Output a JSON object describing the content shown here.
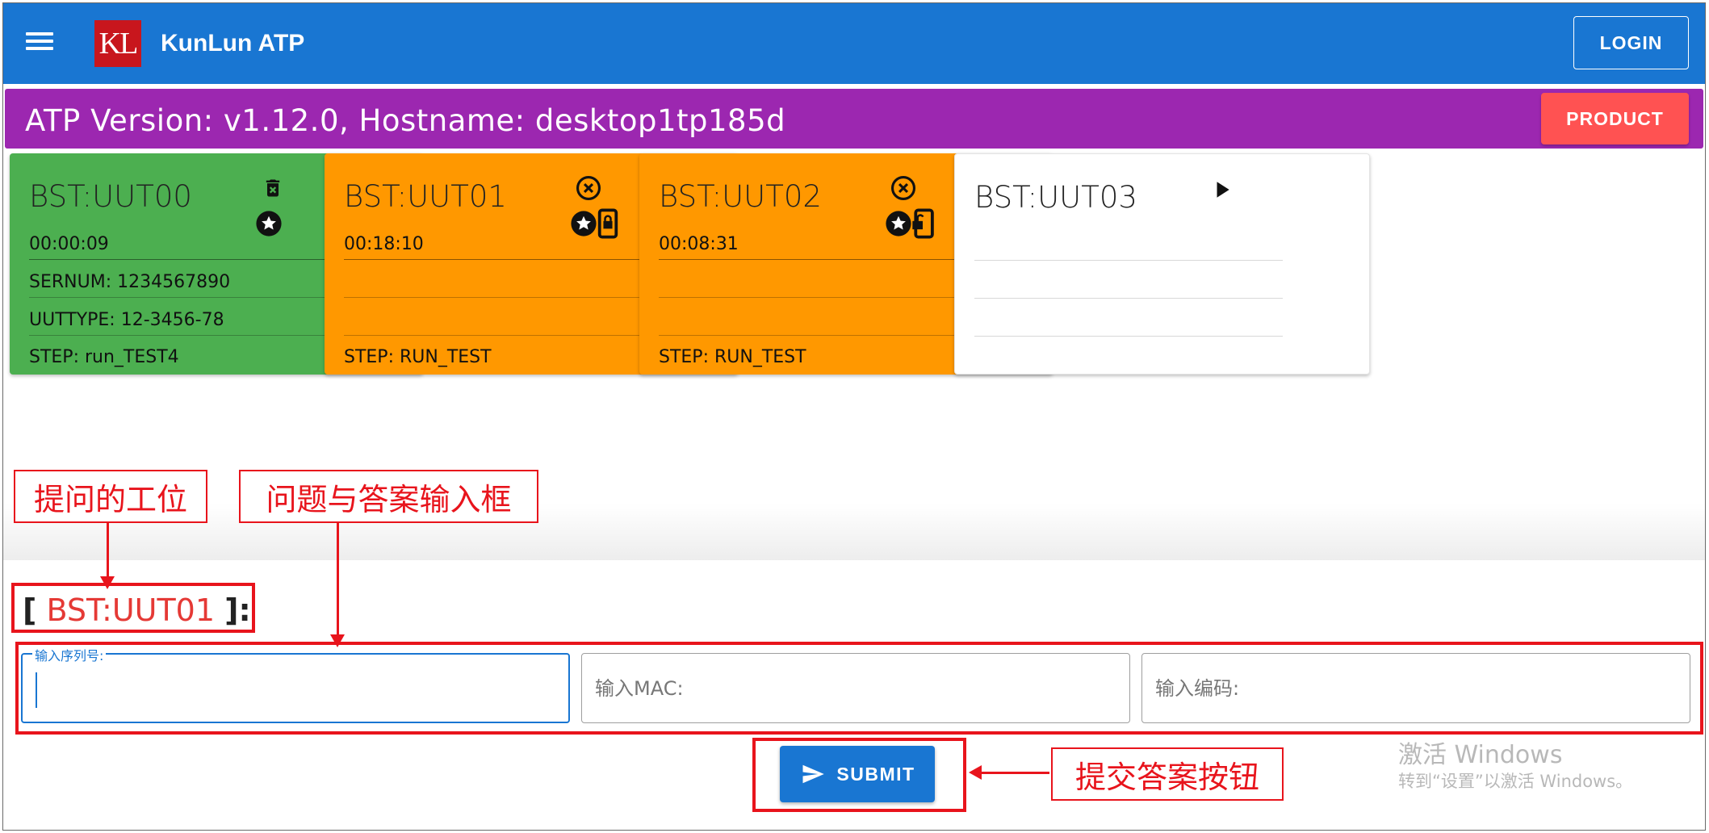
{
  "appbar": {
    "title": "KunLun ATP",
    "logo_text": "KL",
    "login_label": "LOGIN",
    "menu_icon": "hamburger-menu-icon"
  },
  "version_bar": {
    "text": "ATP Version: v1.12.0, Hostname: desktop1tp185d",
    "product_label": "PRODUCT"
  },
  "stations": [
    {
      "title": "BST:UUT00",
      "status": "green",
      "time": "00:00:09",
      "sernum": "SERNUM: 1234567890",
      "uuttype": "UUTTYPE: 12-3456-78",
      "step": "STEP: run_TEST4",
      "icons": [
        "delete-icon",
        "star-icon"
      ]
    },
    {
      "title": "BST:UUT01",
      "status": "orange",
      "time": "00:18:10",
      "sernum": "",
      "uuttype": "",
      "step": "STEP: RUN_TEST",
      "icons": [
        "cancel-icon",
        "star-icon",
        "phone-lock-icon"
      ]
    },
    {
      "title": "BST:UUT02",
      "status": "orange",
      "time": "00:08:31",
      "sernum": "",
      "uuttype": "",
      "step": "STEP: RUN_TEST",
      "icons": [
        "cancel-icon",
        "star-icon",
        "phone-unlock-icon"
      ]
    },
    {
      "title": "BST:UUT03",
      "status": "idle",
      "time": "",
      "sernum": "",
      "uuttype": "",
      "step": "",
      "icons": [
        "play-icon"
      ]
    }
  ],
  "question": {
    "bracket_open": "[",
    "station": "BST:UUT01",
    "bracket_close": "]:",
    "fields": [
      {
        "label": "输入序列号:",
        "placeholder": "",
        "value": ""
      },
      {
        "label": "",
        "placeholder": "输入MAC:",
        "value": ""
      },
      {
        "label": "",
        "placeholder": "输入编码:",
        "value": ""
      }
    ],
    "submit_label": "SUBMIT"
  },
  "annotations": {
    "station_note": "提问的工位",
    "input_note": "问题与答案输入框",
    "submit_note": "提交答案按钮"
  },
  "watermark": {
    "line1": "激活 Windows",
    "line2": "转到“设置”以激活 Windows。"
  },
  "colors": {
    "appbar": "#1976d2",
    "version_bar": "#9c27b0",
    "product_button": "#ff5252",
    "card_running_ok": "#4caf50",
    "card_waiting": "#ff9800",
    "annotation_red": "#e8141c"
  }
}
